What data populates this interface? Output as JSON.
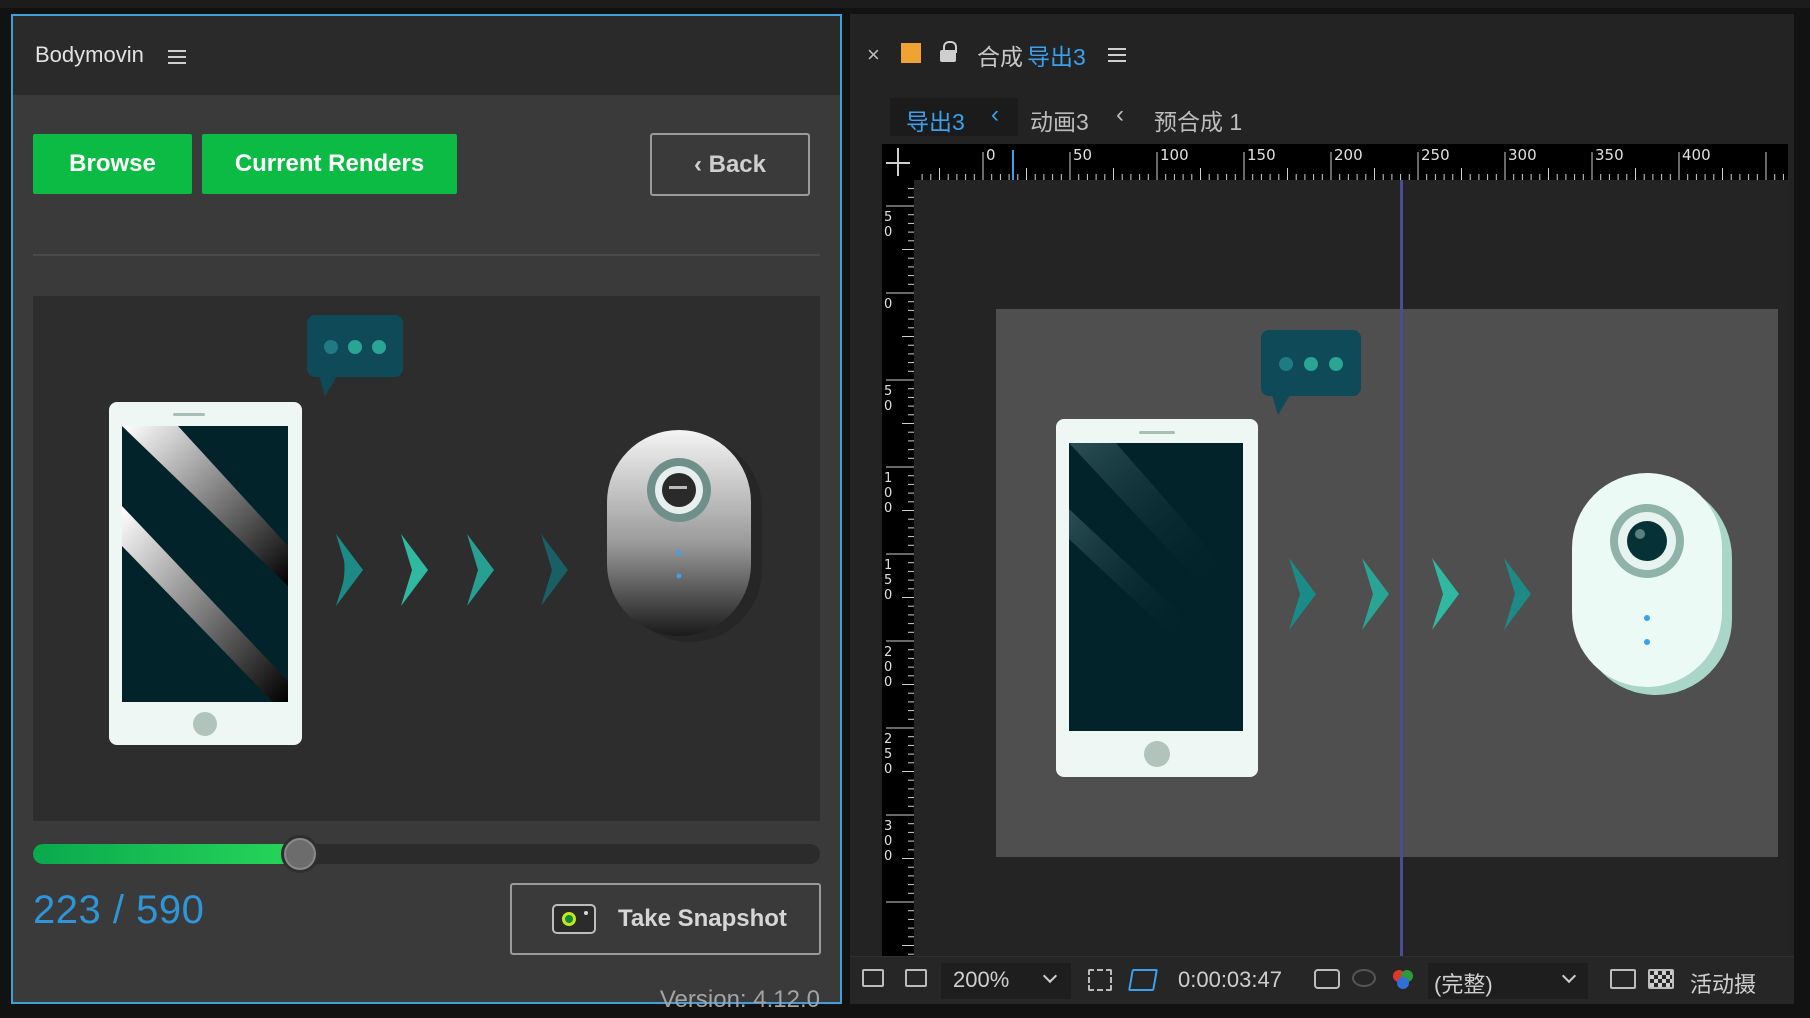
{
  "bodymovin": {
    "title": "Bodymovin",
    "browse_label": "Browse",
    "renders_label": "Current Renders",
    "back_label": "‹ Back",
    "frame_current": 223,
    "frame_total": 590,
    "frame_display": "223 / 590",
    "snapshot_label": "Take Snapshot",
    "version": "Version: 4.12.0"
  },
  "ae": {
    "close_symbol": "×",
    "comp_prefix": "合成",
    "comp_name": "导出3",
    "crumbs": [
      "导出3",
      "动画3",
      "预合成 1"
    ],
    "ruler_h_labels": [
      "0",
      "50",
      "100",
      "150",
      "200",
      "250",
      "300",
      "350",
      "400"
    ],
    "ruler_v_labels": [
      "50",
      "0",
      "50",
      "100",
      "150",
      "200",
      "250",
      "300"
    ],
    "toolbar": {
      "zoom": "200%",
      "timecode": "0:00:03:47",
      "resolution": "(完整)",
      "camera": "活动摄"
    }
  },
  "colors": {
    "green": "#0cbb43",
    "accent_blue": "#3aa1ee",
    "frame_blue": "#2e95d8",
    "swatch_orange": "#f0a232",
    "teal": "#2aa494",
    "dark_teal": "#0e4a57"
  }
}
